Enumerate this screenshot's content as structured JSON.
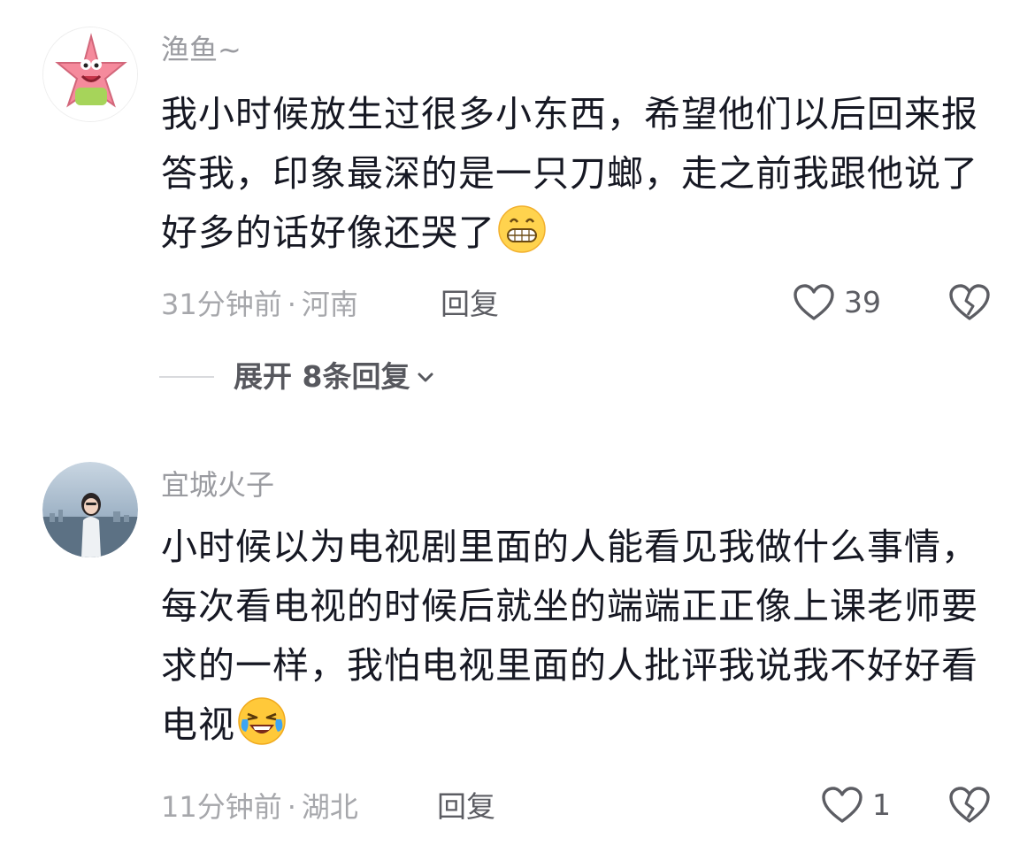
{
  "comments": [
    {
      "username": "渔鱼~",
      "text": "我小时候放生过很多小东西，希望他们以后回来报答我，印象最深的是一只刀螂，走之前我跟他说了好多的话好像还哭了",
      "emoji": "grinning-teeth-emoji",
      "time": "31分钟前",
      "location": "河南",
      "reply_label": "回复",
      "like_count": "39",
      "expand_label": "展开 8条回复"
    },
    {
      "username": "宜城火子",
      "text": "小时候以为电视剧里面的人能看见我做什么事情，每次看电视的时候后就坐的端端正正像上课老师要求的一样，我怕电视里面的人批评我说我不好好看电视",
      "emoji": "laughing-crying-emoji",
      "time": "11分钟前",
      "location": "湖北",
      "reply_label": "回复",
      "like_count": "1"
    }
  ],
  "colors": {
    "text": "#161823",
    "secondary": "#a6a7ab",
    "icon": "#5c5d63"
  }
}
